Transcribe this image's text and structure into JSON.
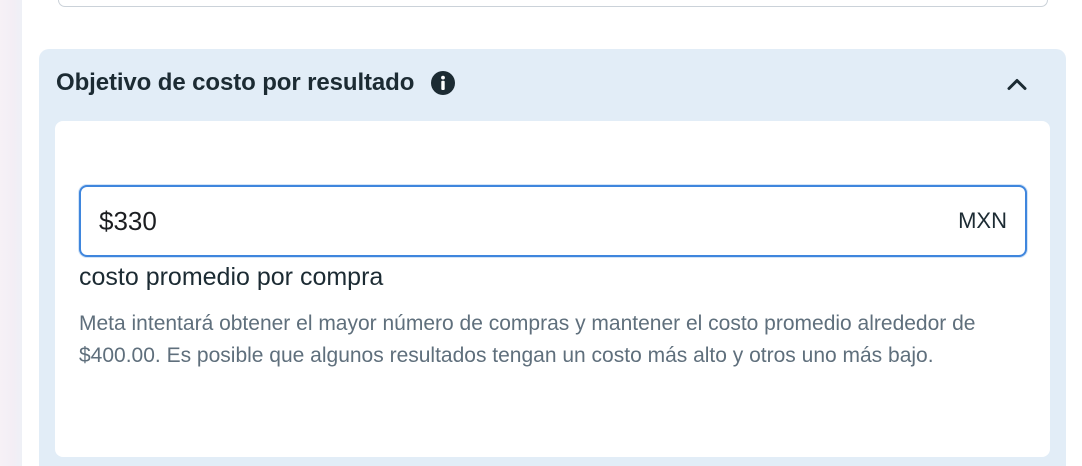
{
  "section": {
    "title": "Objetivo de costo por resultado",
    "info_icon": "info-icon",
    "collapse_icon": "chevron-up-icon"
  },
  "cost_goal": {
    "value": "$330",
    "currency": "MXN",
    "label": "costo promedio por compra",
    "help_text": "Meta intentará obtener el mayor número de compras y mantener el costo promedio alrededor de $400.00. Es posible que algunos resultados tengan un costo más alto y otros uno más bajo."
  },
  "colors": {
    "section_bg": "#e2edf7",
    "input_border": "#3f86dd",
    "title_text": "#1c2b33",
    "help_text": "#5f6f7c"
  }
}
